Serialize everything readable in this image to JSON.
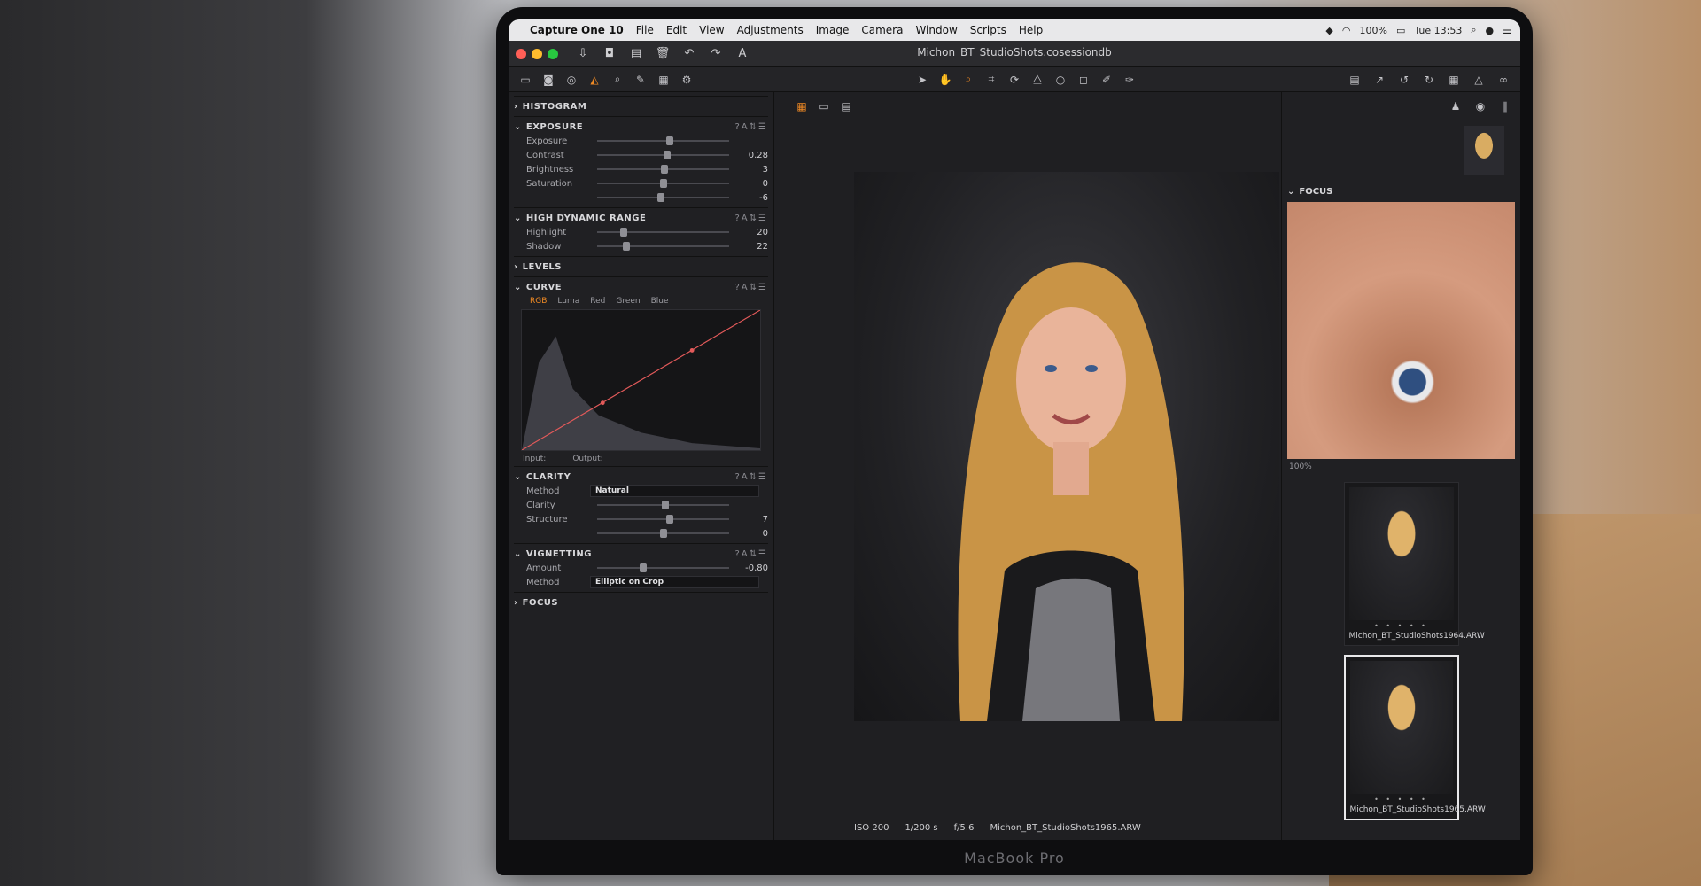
{
  "menubar": {
    "app": "Capture One 10",
    "items": [
      "File",
      "Edit",
      "View",
      "Adjustments",
      "Image",
      "Camera",
      "Window",
      "Scripts",
      "Help"
    ],
    "battery": "100%",
    "clock": "Tue 13:53"
  },
  "session": {
    "title": "Michon_BT_StudioShots.cosessiondb"
  },
  "tools": {
    "histogram": {
      "title": "HISTOGRAM"
    },
    "exposure": {
      "title": "EXPOSURE",
      "rows": [
        {
          "label": "Exposure",
          "value": "",
          "pos": 0.55
        },
        {
          "label": "Contrast",
          "value": "0.28",
          "pos": 0.53
        },
        {
          "label": "Brightness",
          "value": "3",
          "pos": 0.51
        },
        {
          "label": "Saturation",
          "value": "0",
          "pos": 0.5
        },
        {
          "label": "",
          "value": "-6",
          "pos": 0.48
        }
      ]
    },
    "hdr": {
      "title": "HIGH DYNAMIC RANGE",
      "rows": [
        {
          "label": "Highlight",
          "value": "20",
          "pos": 0.2
        },
        {
          "label": "Shadow",
          "value": "22",
          "pos": 0.22
        }
      ]
    },
    "levels": {
      "title": "LEVELS"
    },
    "curve": {
      "title": "CURVE",
      "tabs": [
        "RGB",
        "Luma",
        "Red",
        "Green",
        "Blue"
      ],
      "input": "Input:",
      "output": "Output:"
    },
    "clarity": {
      "title": "CLARITY",
      "method_label": "Method",
      "method_value": "Natural",
      "rows": [
        {
          "label": "Clarity",
          "value": "",
          "pos": 0.52
        },
        {
          "label": "Structure",
          "value": "7",
          "pos": 0.55
        },
        {
          "label": "",
          "value": "0",
          "pos": 0.5
        }
      ]
    },
    "vignetting": {
      "title": "VIGNETTING",
      "rows": [
        {
          "label": "Amount",
          "value": "-0.80",
          "pos": 0.35
        }
      ],
      "method_label": "Method",
      "method_value": "Elliptic on Crop"
    },
    "focus": {
      "title": "FOCUS"
    }
  },
  "viewer": {
    "iso": "ISO 200",
    "shutter": "1/200 s",
    "aperture": "f/5.6",
    "filename": "Michon_BT_StudioShots1965.ARW"
  },
  "right": {
    "focus_title": "FOCUS",
    "zoom": "100%",
    "thumbs": [
      {
        "name": "Michon_BT_StudioShots1964.ARW"
      },
      {
        "name": "Michon_BT_StudioShots1965.ARW"
      }
    ]
  },
  "laptop": {
    "brand": "MacBook Pro"
  }
}
